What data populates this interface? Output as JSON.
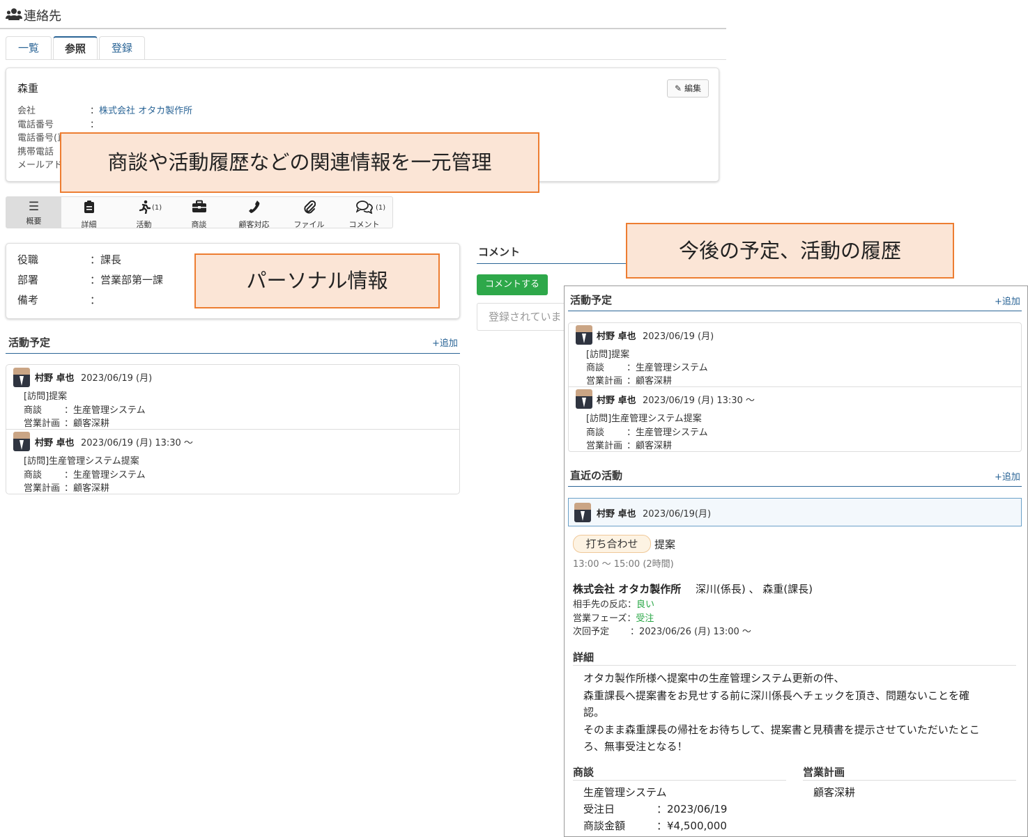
{
  "header": {
    "title": "連絡先",
    "icon": "users-icon"
  },
  "tabs": [
    {
      "label": "一覧"
    },
    {
      "label": "参照"
    },
    {
      "label": "登録"
    }
  ],
  "contact": {
    "name": "森重",
    "edit_label": "編集",
    "fields": [
      {
        "label": "会社",
        "value": "株式会社 オタカ製作所"
      },
      {
        "label": "電話番号",
        "value": ""
      },
      {
        "label": "電話番号(直"
      },
      {
        "label": "携帯電話"
      },
      {
        "label": "メールアド"
      }
    ]
  },
  "callouts": {
    "c1": "商談や活動履歴などの関連情報を一元管理",
    "c2": "パーソナル情報",
    "c3": "今後の予定、活動の履歴"
  },
  "iconbar": [
    {
      "label": "概要",
      "icon": "list-icon",
      "count": ""
    },
    {
      "label": "詳細",
      "icon": "clipboard-icon",
      "count": ""
    },
    {
      "label": "活動",
      "icon": "run-icon",
      "count": "(1)"
    },
    {
      "label": "商談",
      "icon": "briefcase-icon",
      "count": ""
    },
    {
      "label": "顧客対応",
      "icon": "phone-icon",
      "count": ""
    },
    {
      "label": "ファイル",
      "icon": "paperclip-icon",
      "count": ""
    },
    {
      "label": "コメント",
      "icon": "comments-icon",
      "count": "(1)"
    }
  ],
  "personal": [
    {
      "label": "役職",
      "value": "：課長"
    },
    {
      "label": "部署",
      "value": "：営業部第一課"
    },
    {
      "label": "備考",
      "value": "："
    }
  ],
  "comment": {
    "title": "コメント",
    "button": "コメントする",
    "placeholder": "登録されていま"
  },
  "schedule": {
    "title": "活動予定",
    "add": "+追加",
    "items": [
      {
        "user": "村野 卓也",
        "date": "2023/06/19 (月)",
        "subject": "[訪問]提案",
        "deal_label": "商談",
        "deal": "：生産管理システム",
        "plan_label": "営業計画",
        "plan": "：顧客深耕"
      },
      {
        "user": "村野 卓也",
        "date": "2023/06/19 (月) 13:30 ～",
        "subject": "[訪問]生産管理システム提案",
        "deal_label": "商談",
        "deal": "：生産管理システム",
        "plan_label": "営業計画",
        "plan": "：顧客深耕"
      }
    ]
  },
  "recent": {
    "title": "直近の活動",
    "add": "+追加",
    "user": "村野 卓也",
    "date": "2023/06/19(月)",
    "badge": "打ち合わせ",
    "subject": "提案",
    "time": "13:00 ～ 15:00 (2時間)",
    "company": "株式会社 オタカ製作所",
    "attendees": "深川(係長) 、 森重(課長)",
    "reaction_label": "相手先の反応：",
    "reaction": "良い",
    "phase_label": "営業フェーズ：",
    "phase": "受注",
    "next_label": "次回予定",
    "next": "：2023/06/26 (月) 13:00 ～",
    "detail_title": "詳細",
    "detail_lines": [
      "オタカ製作所様へ提案中の生産管理システム更新の件、",
      "森重課長へ提案書をお見せする前に深川係長へチェックを頂き、問題ないことを確",
      "認。",
      "そのまま森重課長の帰社をお待ちして、提案書と見積書を提示させていただいたとこ",
      "ろ、無事受注となる！"
    ],
    "deal_title": "商談",
    "deal_name": "生産管理システム",
    "order_label": "受注日",
    "order_date": "：2023/06/19",
    "amount_label": "商談金額",
    "amount": "：¥4,500,000",
    "plan_title": "営業計画",
    "plan_name": "顧客深耕"
  },
  "colors": {
    "accent": "#2a6496",
    "callout_bg": "#fbe5d6",
    "callout_border": "#ed7d31",
    "green": "#2ea84a"
  }
}
